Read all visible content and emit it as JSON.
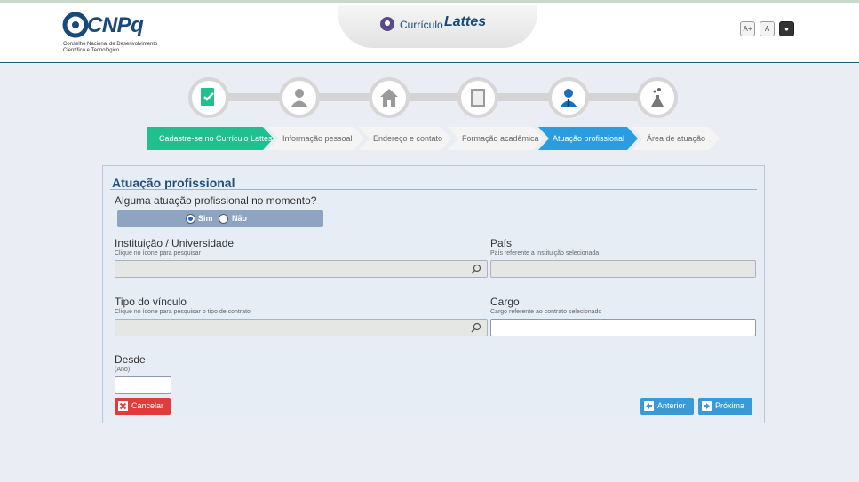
{
  "header": {
    "logo_text": "CNPq",
    "logo_subtitle": "Conselho Nacional de Desenvolvimento Científico e Tecnológico",
    "app_small": "Currículo",
    "app_big": "Lattes",
    "font_buttons": {
      "increase": "A+",
      "normal": "A",
      "contrast": "●"
    }
  },
  "steps": [
    "certificate-icon",
    "user-icon",
    "home-icon",
    "book-icon",
    "professional-icon",
    "flask-icon"
  ],
  "breadcrumb": [
    {
      "label": "Cadastre-se no Currículo Lattes",
      "state": "done"
    },
    {
      "label": "Informação pessoal",
      "state": "pending"
    },
    {
      "label": "Endereço e contato",
      "state": "pending"
    },
    {
      "label": "Formação acadêmica",
      "state": "pending"
    },
    {
      "label": "Atuação profissional",
      "state": "active"
    },
    {
      "label": "Área de atuação",
      "state": "pending"
    }
  ],
  "form": {
    "title": "Atuação profissional",
    "question": "Alguma atuação profissional no momento?",
    "options": {
      "yes": "Sim",
      "no": "Não",
      "selected": "Sim"
    },
    "institution": {
      "label": "Instituição / Universidade",
      "hint": "Clique no ícone para pesquisar",
      "value": ""
    },
    "country": {
      "label": "País",
      "hint": "País referente a instituição selecionada",
      "value": ""
    },
    "bond_type": {
      "label": "Tipo do vínculo",
      "hint": "Clique no ícone para pesquisar o tipo de contrato",
      "value": ""
    },
    "position": {
      "label": "Cargo",
      "hint": "Cargo referente ao contrato selecionado",
      "value": ""
    },
    "since": {
      "label": "Desde",
      "hint": "(Ano)",
      "value": ""
    }
  },
  "buttons": {
    "cancel": "Cancelar",
    "previous": "Anterior",
    "next": "Próxima"
  },
  "colors": {
    "done": "#1fc08d",
    "active": "#2a9de0",
    "cancel": "#e03c3c",
    "nav": "#3a9ad8",
    "title": "#244f77"
  }
}
